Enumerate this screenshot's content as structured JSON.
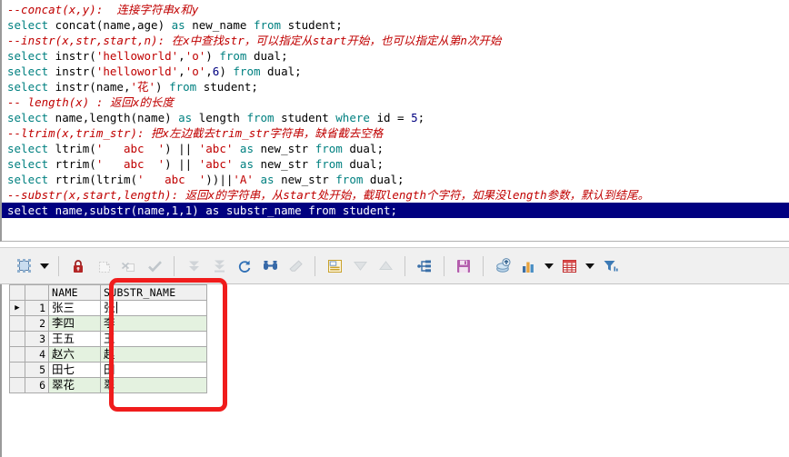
{
  "editor": {
    "name": "sql-worksheet",
    "lines": [
      {
        "type": "comment",
        "text": "--concat(x,y):  连接字符串x和y"
      },
      {
        "type": "code",
        "parts": [
          {
            "c": "kw",
            "t": "select"
          },
          {
            "c": "plain",
            "t": " concat(name,age) "
          },
          {
            "c": "kw",
            "t": "as"
          },
          {
            "c": "plain",
            "t": " new_name "
          },
          {
            "c": "kw",
            "t": "from"
          },
          {
            "c": "plain",
            "t": " student;"
          }
        ]
      },
      {
        "type": "comment",
        "text": "--instr(x,str,start,n): 在x中查找str，可以指定从start开始，也可以指定从第n次开始"
      },
      {
        "type": "code",
        "parts": [
          {
            "c": "kw",
            "t": "select"
          },
          {
            "c": "plain",
            "t": " instr("
          },
          {
            "c": "str",
            "t": "'helloworld'"
          },
          {
            "c": "plain",
            "t": ","
          },
          {
            "c": "str",
            "t": "'o'"
          },
          {
            "c": "plain",
            "t": ") "
          },
          {
            "c": "kw",
            "t": "from"
          },
          {
            "c": "plain",
            "t": " dual;"
          }
        ]
      },
      {
        "type": "code",
        "parts": [
          {
            "c": "kw",
            "t": "select"
          },
          {
            "c": "plain",
            "t": " instr("
          },
          {
            "c": "str",
            "t": "'helloworld'"
          },
          {
            "c": "plain",
            "t": ","
          },
          {
            "c": "str",
            "t": "'o'"
          },
          {
            "c": "plain",
            "t": ","
          },
          {
            "c": "num",
            "t": "6"
          },
          {
            "c": "plain",
            "t": ") "
          },
          {
            "c": "kw",
            "t": "from"
          },
          {
            "c": "plain",
            "t": " dual;"
          }
        ]
      },
      {
        "type": "code",
        "parts": [
          {
            "c": "kw",
            "t": "select"
          },
          {
            "c": "plain",
            "t": " instr(name,"
          },
          {
            "c": "str",
            "t": "'花'"
          },
          {
            "c": "plain",
            "t": ") "
          },
          {
            "c": "kw",
            "t": "from"
          },
          {
            "c": "plain",
            "t": " student;"
          }
        ]
      },
      {
        "type": "comment",
        "text": "-- length(x) : 返回x的长度"
      },
      {
        "type": "code",
        "parts": [
          {
            "c": "kw",
            "t": "select"
          },
          {
            "c": "plain",
            "t": " name,length(name) "
          },
          {
            "c": "kw",
            "t": "as"
          },
          {
            "c": "plain",
            "t": " length "
          },
          {
            "c": "kw",
            "t": "from"
          },
          {
            "c": "plain",
            "t": " student "
          },
          {
            "c": "kw",
            "t": "where"
          },
          {
            "c": "plain",
            "t": " id = "
          },
          {
            "c": "num",
            "t": "5"
          },
          {
            "c": "plain",
            "t": ";"
          }
        ]
      },
      {
        "type": "comment",
        "text": "--ltrim(x,trim_str): 把x左边截去trim_str字符串，缺省截去空格"
      },
      {
        "type": "code",
        "parts": [
          {
            "c": "kw",
            "t": "select"
          },
          {
            "c": "plain",
            "t": " ltrim("
          },
          {
            "c": "str",
            "t": "'   abc  '"
          },
          {
            "c": "plain",
            "t": ") || "
          },
          {
            "c": "str",
            "t": "'abc'"
          },
          {
            "c": "plain",
            "t": " "
          },
          {
            "c": "kw",
            "t": "as"
          },
          {
            "c": "plain",
            "t": " new_str "
          },
          {
            "c": "kw",
            "t": "from"
          },
          {
            "c": "plain",
            "t": " dual;"
          }
        ]
      },
      {
        "type": "code",
        "parts": [
          {
            "c": "kw",
            "t": "select"
          },
          {
            "c": "plain",
            "t": " rtrim("
          },
          {
            "c": "str",
            "t": "'   abc  '"
          },
          {
            "c": "plain",
            "t": ") || "
          },
          {
            "c": "str",
            "t": "'abc'"
          },
          {
            "c": "plain",
            "t": " "
          },
          {
            "c": "kw",
            "t": "as"
          },
          {
            "c": "plain",
            "t": " new_str "
          },
          {
            "c": "kw",
            "t": "from"
          },
          {
            "c": "plain",
            "t": " dual;"
          }
        ]
      },
      {
        "type": "code",
        "parts": [
          {
            "c": "kw",
            "t": "select"
          },
          {
            "c": "plain",
            "t": " rtrim(ltrim("
          },
          {
            "c": "str",
            "t": "'   abc  '"
          },
          {
            "c": "plain",
            "t": "))||"
          },
          {
            "c": "str",
            "t": "'A'"
          },
          {
            "c": "plain",
            "t": " "
          },
          {
            "c": "kw",
            "t": "as"
          },
          {
            "c": "plain",
            "t": " new_str "
          },
          {
            "c": "kw",
            "t": "from"
          },
          {
            "c": "plain",
            "t": " dual;"
          }
        ]
      },
      {
        "type": "comment",
        "text": "--substr(x,start,length): 返回x的字符串，从start处开始，截取length个字符，如果没length参数，默认到结尾。"
      },
      {
        "type": "code",
        "selected": true,
        "parts": [
          {
            "c": "kw",
            "t": "select"
          },
          {
            "c": "plain",
            "t": " name,substr(name,"
          },
          {
            "c": "num",
            "t": "1"
          },
          {
            "c": "plain",
            "t": ","
          },
          {
            "c": "num",
            "t": "1"
          },
          {
            "c": "plain",
            "t": ") "
          },
          {
            "c": "kw",
            "t": "as"
          },
          {
            "c": "plain",
            "t": " substr_name "
          },
          {
            "c": "kw",
            "t": "from"
          },
          {
            "c": "plain",
            "t": " student;"
          }
        ]
      }
    ],
    "colors": {
      "comment": "#c00000",
      "keyword": "#008080",
      "string": "#c00000",
      "number": "#000080",
      "selection_bg": "#000080",
      "selection_fg": "#ffffff"
    }
  },
  "toolbar": {
    "name": "results-toolbar",
    "items": [
      {
        "icon": "freeze-grid-icon",
        "label": "Freeze Grid",
        "enabled": true,
        "caret": true
      },
      {
        "sep": true
      },
      {
        "icon": "lock-icon",
        "label": "Lock Record",
        "enabled": true
      },
      {
        "icon": "insert-record-icon",
        "label": "Insert Record",
        "enabled": false
      },
      {
        "icon": "delete-record-icon",
        "label": "Delete Record",
        "enabled": false
      },
      {
        "icon": "commit-check-icon",
        "label": "Commit Changes",
        "enabled": false
      },
      {
        "sep": true
      },
      {
        "icon": "fetch-next-icon",
        "label": "Fetch Next Set",
        "enabled": false
      },
      {
        "icon": "fetch-all-icon",
        "label": "Fetch All Rows",
        "enabled": false
      },
      {
        "icon": "refresh-icon",
        "label": "Refresh Data",
        "enabled": true
      },
      {
        "icon": "find-icon",
        "label": "Find / Search Data",
        "enabled": true
      },
      {
        "icon": "eraser-icon",
        "label": "Clear Filter",
        "enabled": false
      },
      {
        "sep": true
      },
      {
        "icon": "single-record-icon",
        "label": "Single Record View",
        "enabled": true
      },
      {
        "icon": "move-down-icon",
        "label": "Move Down",
        "enabled": false
      },
      {
        "icon": "move-up-icon",
        "label": "Move Up",
        "enabled": false
      },
      {
        "sep": true
      },
      {
        "icon": "export-data-icon",
        "label": "Export Data",
        "enabled": true
      },
      {
        "sep": true
      },
      {
        "icon": "save-icon",
        "label": "Save Results",
        "enabled": true
      },
      {
        "sep": true
      },
      {
        "icon": "upload-data-icon",
        "label": "Upload / Load Data",
        "enabled": true
      },
      {
        "icon": "chart-icon",
        "label": "Chart View",
        "enabled": true,
        "caret": true
      },
      {
        "icon": "grid-view-icon",
        "label": "Grid View",
        "enabled": true,
        "caret": true
      },
      {
        "icon": "filter-icon",
        "label": "Filter Data",
        "enabled": true
      }
    ]
  },
  "results_grid": {
    "name": "query-results-grid",
    "columns": [
      "NAME",
      "SUBSTR_NAME"
    ],
    "rows": [
      {
        "num": "1",
        "marker": "▶",
        "NAME": "张三",
        "SUBSTR_NAME": "张",
        "current": true
      },
      {
        "num": "2",
        "marker": "",
        "NAME": "李四",
        "SUBSTR_NAME": "李",
        "alt": true
      },
      {
        "num": "3",
        "marker": "",
        "NAME": "王五",
        "SUBSTR_NAME": "王"
      },
      {
        "num": "4",
        "marker": "",
        "NAME": "赵六",
        "SUBSTR_NAME": "赵",
        "alt": true
      },
      {
        "num": "5",
        "marker": "",
        "NAME": "田七",
        "SUBSTR_NAME": "田"
      },
      {
        "num": "6",
        "marker": "",
        "NAME": "翠花",
        "SUBSTR_NAME": "翠",
        "alt": true
      }
    ],
    "row_count": 6,
    "alt_row_color": "#e4f2e0"
  },
  "annotation": {
    "name": "red-highlight-box",
    "color": "#f01c1c",
    "target_column": "SUBSTR_NAME"
  }
}
